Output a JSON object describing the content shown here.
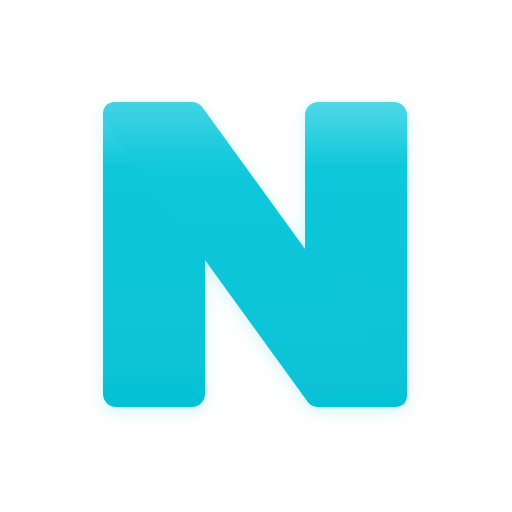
{
  "logo": {
    "icon": "letter-n-logo-icon",
    "letter": "N",
    "colors": {
      "background": "#ffffff",
      "primary": "#06c4d8",
      "highlight": "#4fd8e6",
      "shadow": "#057c8c"
    }
  }
}
